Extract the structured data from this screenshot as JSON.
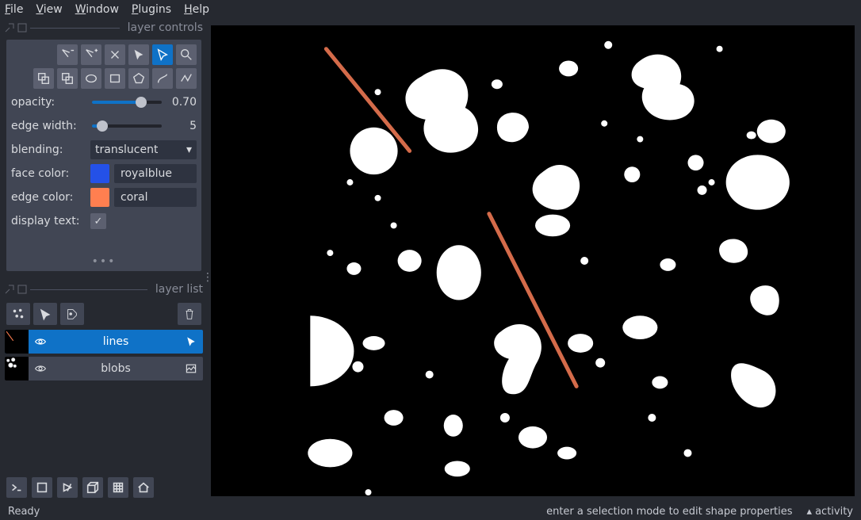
{
  "menu": {
    "file": "File",
    "view": "View",
    "window": "Window",
    "plugins": "Plugins",
    "help": "Help"
  },
  "panels": {
    "controls_title": "layer controls",
    "list_title": "layer list"
  },
  "props": {
    "opacity_label": "opacity:",
    "opacity_value": "0.70",
    "edgewidth_label": "edge width:",
    "edgewidth_value": "5",
    "blending_label": "blending:",
    "blending_value": "translucent",
    "facecolor_label": "face color:",
    "facecolor_name": "royalblue",
    "facecolor_hex": "#2451e8",
    "edgecolor_label": "edge color:",
    "edgecolor_name": "coral",
    "edgecolor_hex": "#ff7f50",
    "displaytext_label": "display text:"
  },
  "layers": [
    {
      "name": "lines"
    },
    {
      "name": "blobs"
    }
  ],
  "status": {
    "ready": "Ready",
    "hint": "enter a selection mode to edit shape properties",
    "activity": "activity"
  }
}
